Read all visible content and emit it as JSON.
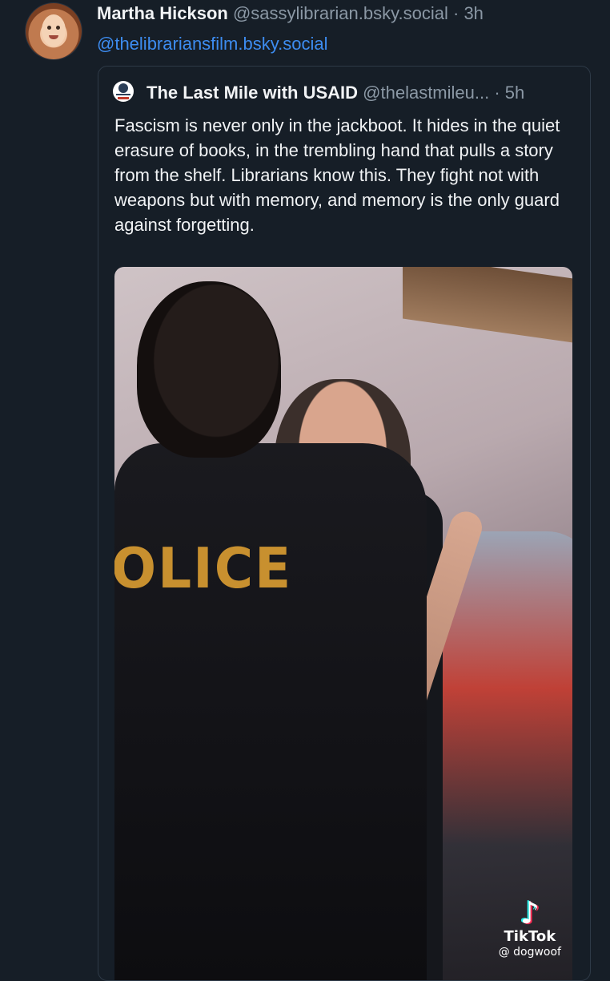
{
  "post": {
    "author_name": "Martha Hickson",
    "author_handle": "@sassylibrarian.bsky.social",
    "separator": "·",
    "time": "3h",
    "mention": "@thelibrariansfilm.bsky.social"
  },
  "quote": {
    "author_name": "The Last Mile with USAID",
    "author_handle": "@thelastmileu...",
    "separator": "·",
    "time": "5h",
    "text": "Fascism is never only in the jackboot. It hides in the quiet erasure of books, in the trembling hand that pulls a story from the shelf. Librarians know this. They fight not with weapons but with memory, and memory is the only guard against forgetting."
  },
  "media": {
    "overlay_text": "OLICE",
    "tiktok_logo_icon": "tiktok-note-icon",
    "tiktok_name": "TikTok",
    "tiktok_handle": "@ dogwoof"
  },
  "colors": {
    "background": "#161e27",
    "link": "#3d8cf0",
    "muted": "#8b98a5",
    "text": "#f1f3f5"
  }
}
